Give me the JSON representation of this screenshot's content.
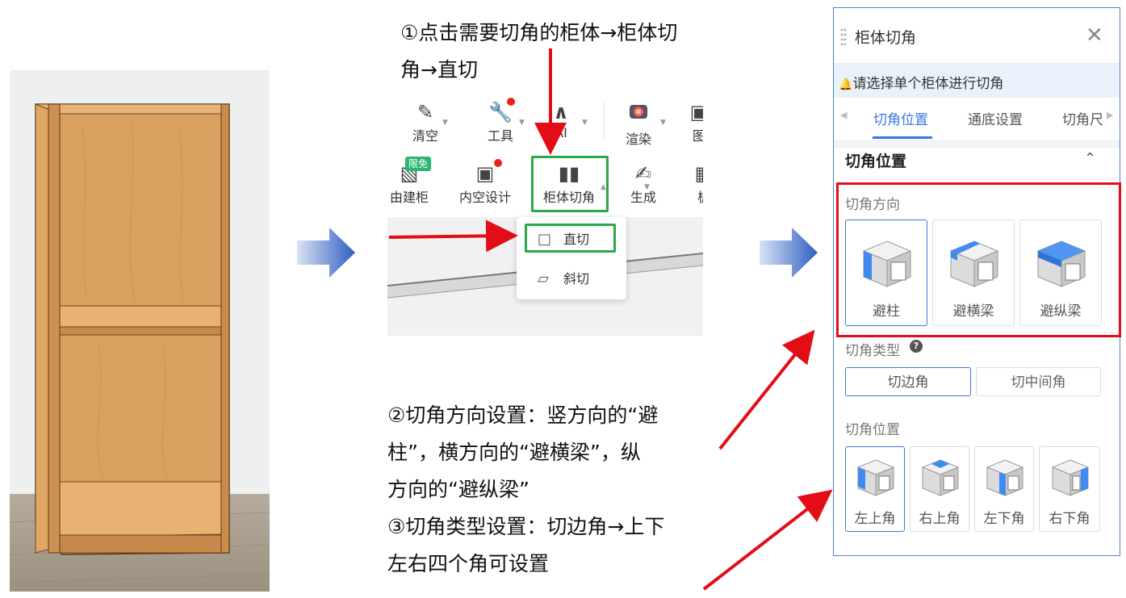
{
  "step1": {
    "line1": "①点击需要切角的柜体→柜体切",
    "line2": "角→直切"
  },
  "steps23": {
    "line1": "②切角方向设置：竖方向的“避",
    "line2": "柱”，横方向的“避横梁”，纵",
    "line3": "方向的“避纵梁”",
    "line4": "③切角类型设置：切边角→上下",
    "line5": "左右四个角可设置"
  },
  "toolbar": {
    "row1": [
      {
        "label": "清空",
        "icon": "eraser-icon"
      },
      {
        "label": "工具",
        "icon": "wrench-icon"
      },
      {
        "label": "AI",
        "icon": "ai-icon"
      },
      {
        "label": "渲染",
        "icon": "camera-icon"
      },
      {
        "label": "图",
        "icon": "image-icon"
      }
    ],
    "row2": [
      {
        "label": "由建柜",
        "icon": "cabinet-build-icon",
        "badge": "限免"
      },
      {
        "label": "内空设计",
        "icon": "inner-space-icon"
      },
      {
        "label": "柜体切角",
        "icon": "cabinet-cut-icon"
      },
      {
        "label": "生成",
        "icon": "generate-icon"
      },
      {
        "label": "板",
        "icon": "board-icon"
      }
    ],
    "dropdown": [
      {
        "label": "直切",
        "icon": "straight-cut-icon"
      },
      {
        "label": "斜切",
        "icon": "bevel-cut-icon"
      }
    ]
  },
  "panel": {
    "title": "柜体切角",
    "notice": "请选择单个柜体进行切角",
    "tabs": [
      "切角位置",
      "通底设置",
      "切角尺"
    ],
    "active_tab": "切角位置",
    "section_title": "切角位置",
    "direction": {
      "label": "切角方向",
      "options": [
        "避柱",
        "避横梁",
        "避纵梁"
      ],
      "selected": "避柱"
    },
    "type": {
      "label": "切角类型",
      "options": [
        "切边角",
        "切中间角"
      ],
      "selected": "切边角"
    },
    "position": {
      "label": "切角位置",
      "options": [
        "左上角",
        "右上角",
        "左下角",
        "右下角"
      ],
      "selected": "左上角"
    }
  },
  "colors": {
    "accent": "#3978e1",
    "highlight_red": "#e30d17",
    "highlight_green": "#2aa84a",
    "wood": "#d79a56"
  }
}
